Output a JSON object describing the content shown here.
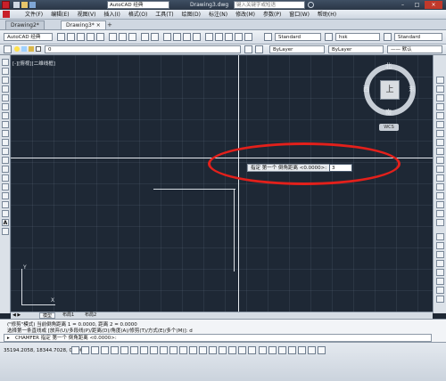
{
  "window": {
    "workspace": "AutoCAD 经典",
    "file_title": "Drawing3.dwg",
    "search_placeholder": "键入关键字或短语"
  },
  "menu": [
    "文件(F)",
    "编辑(E)",
    "视图(V)",
    "插入(I)",
    "格式(O)",
    "工具(T)",
    "绘图(D)",
    "标注(N)",
    "修改(M)",
    "参数(P)",
    "窗口(W)",
    "帮助(H)"
  ],
  "doc_tabs": [
    {
      "label": "Drawing2*",
      "active": false
    },
    {
      "label": "Drawing3*",
      "active": true
    }
  ],
  "toolbar": {
    "workspace_combo": "AutoCAD 经典",
    "text_style": "Standard",
    "dim_style": "hsk",
    "table_style": "Standard",
    "layer_value": "0",
    "color_value": "ByLayer",
    "linetype_value": "ByLayer",
    "lineweight_value": "—— 默认"
  },
  "viewport_label": "[-][俯视][二维线框]",
  "viewcube": {
    "north": "北",
    "south": "南",
    "east": "东",
    "west": "西",
    "face": "上",
    "wcs": "WCS"
  },
  "dynamic_input": {
    "prompt": "指定 第一个 倒角距离 <0.0000>:",
    "value": "3"
  },
  "axis": {
    "x": "X",
    "y": "Y"
  },
  "layout_tabs": [
    "模型",
    "布局1",
    "布局2"
  ],
  "command_history": [
    "(\"修剪\"模式) 当前倒角距离 1 = 0.0000, 距离 2 = 0.0000",
    "选择第一条直线或 [放弃(U)/多段线(P)/距离(D)/角度(A)/修剪(T)/方式(E)/多个(M)]: d"
  ],
  "command_current": "CHAMFER 指定 第一个 倒角距离 <0.0000>:",
  "status": {
    "coordinates": "35194.2058, 18344.7028, 0.0000"
  },
  "colors": {
    "canvas": "#1e2835",
    "highlight_ellipse": "#e3201b",
    "crosshair": "#e6ebf0"
  }
}
